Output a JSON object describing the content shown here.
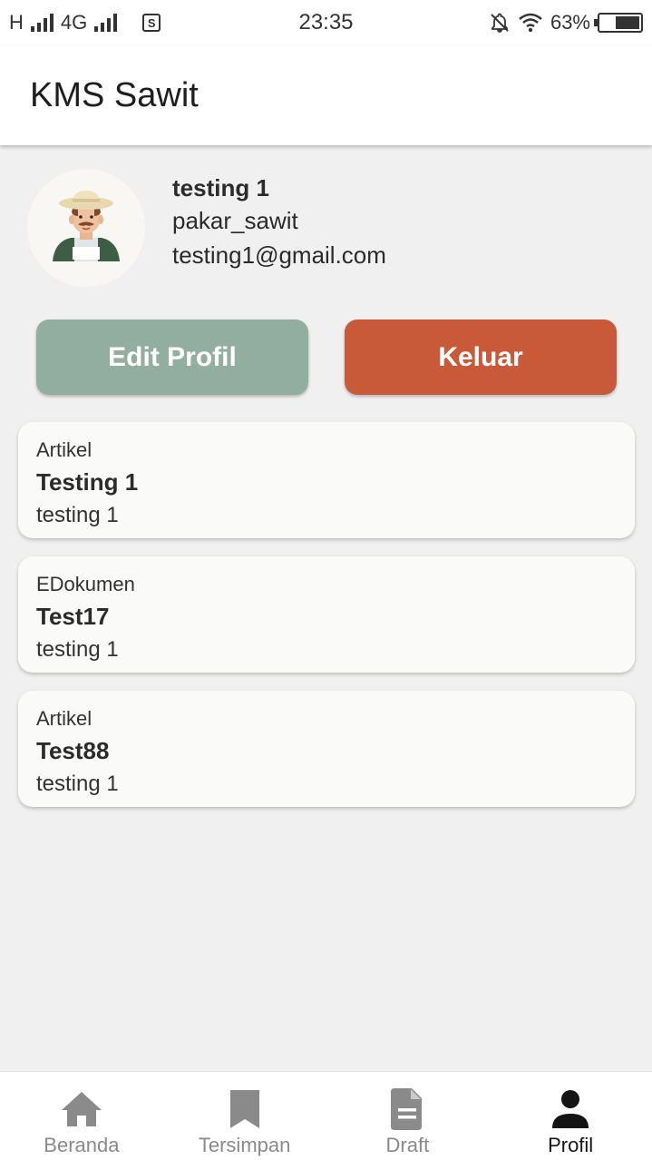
{
  "status_bar": {
    "network_h": "H",
    "network_4g": "4G",
    "sim_label": "S",
    "time": "23:35",
    "battery": "63%",
    "battery_level": 0.63
  },
  "app_bar": {
    "title": "KMS Sawit"
  },
  "profile": {
    "name": "testing 1",
    "role": "pakar_sawit",
    "email": "testing1@gmail.com",
    "avatar_icon": "farmer-avatar-icon"
  },
  "actions": {
    "edit_label": "Edit Profil",
    "logout_label": "Keluar"
  },
  "colors": {
    "edit_button": "#92aea0",
    "logout_button": "#c85a3a",
    "nav_active": "#141414",
    "nav_inactive": "#8a8a8a"
  },
  "cards": [
    {
      "type": "Artikel",
      "title": "Testing 1",
      "author": "testing 1"
    },
    {
      "type": "EDokumen",
      "title": "Test17",
      "author": "testing 1"
    },
    {
      "type": "Artikel",
      "title": "Test88",
      "author": "testing 1"
    }
  ],
  "bottom_nav": {
    "items": [
      {
        "label": "Beranda",
        "icon": "home-icon"
      },
      {
        "label": "Tersimpan",
        "icon": "bookmark-icon"
      },
      {
        "label": "Draft",
        "icon": "document-icon"
      },
      {
        "label": "Profil",
        "icon": "person-icon",
        "active": true
      }
    ]
  }
}
